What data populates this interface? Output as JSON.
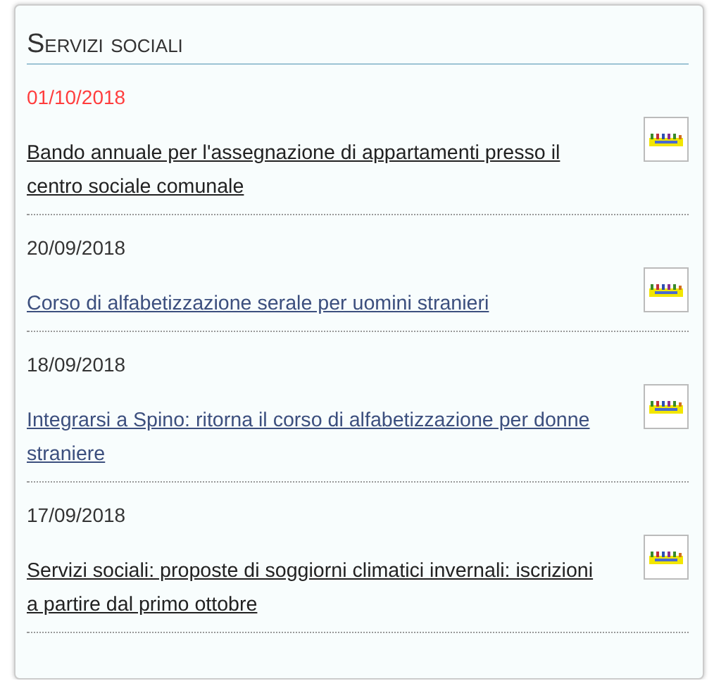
{
  "panel": {
    "title": "Servizi sociali"
  },
  "news": [
    {
      "date": "01/10/2018",
      "highlighted": true,
      "title": "Bando annuale per l'assegnazione di appartamenti presso il centro sociale comunale",
      "visited": false
    },
    {
      "date": "20/09/2018",
      "highlighted": false,
      "title": "Corso di alfabetizzazione serale per uomini stranieri",
      "visited": true
    },
    {
      "date": "18/09/2018",
      "highlighted": false,
      "title": "Integrarsi a Spino: ritorna il corso di alfabetizzazione per donne straniere",
      "visited": true
    },
    {
      "date": "17/09/2018",
      "highlighted": false,
      "title": "Servizi sociali: proposte di soggiorni climatici invernali: iscrizioni a partire dal primo ottobre",
      "visited": false
    }
  ]
}
